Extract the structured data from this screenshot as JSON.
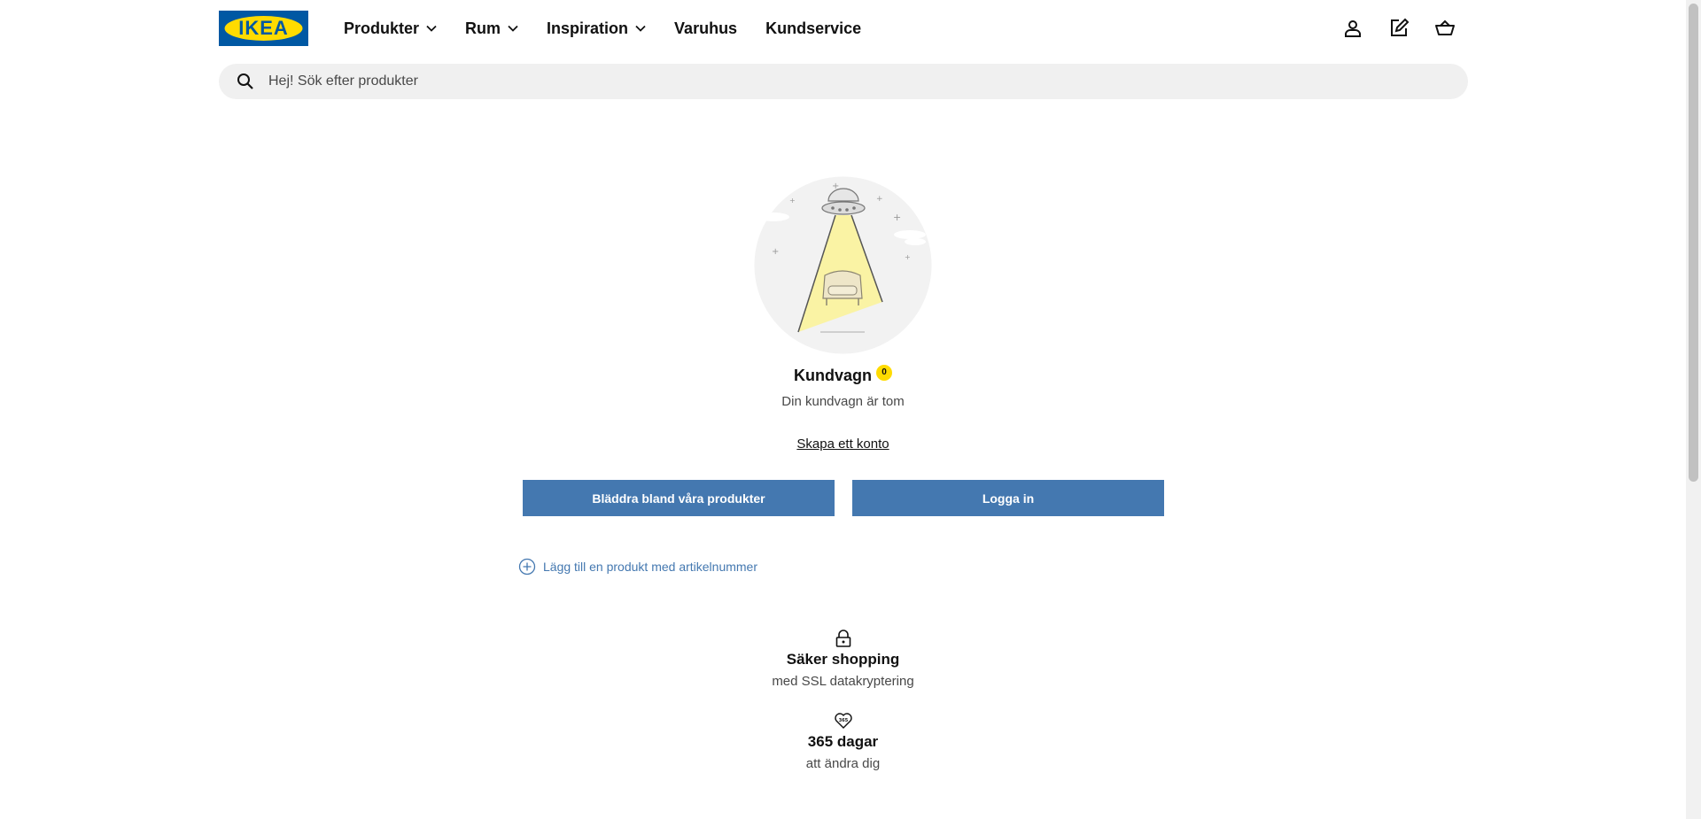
{
  "logo": {
    "text": "IKEA",
    "brand_blue": "#0058a3",
    "brand_yellow": "#ffdb00"
  },
  "nav": {
    "items": [
      {
        "label": "Produkter",
        "has_dropdown": true
      },
      {
        "label": "Rum",
        "has_dropdown": true
      },
      {
        "label": "Inspiration",
        "has_dropdown": true
      },
      {
        "label": "Varuhus",
        "has_dropdown": false
      },
      {
        "label": "Kundservice",
        "has_dropdown": false
      }
    ]
  },
  "header_icons": [
    "user-icon",
    "shopping-list-icon",
    "cart-icon"
  ],
  "search": {
    "placeholder": "Hej! Sök efter produkter"
  },
  "cart": {
    "title": "Kundvagn",
    "count": "0",
    "empty_message": "Din kundvagn är tom",
    "create_account_label": "Skapa ett konto",
    "browse_button_label": "Bläddra bland våra produkter",
    "login_button_label": "Logga in",
    "add_by_article_label": "Lägg till en produkt med artikelnummer",
    "accent_color": "#4478b0"
  },
  "features": [
    {
      "icon": "lock-icon",
      "title": "Säker shopping",
      "subtitle": "med SSL datakryptering"
    },
    {
      "icon": "heart-365-icon",
      "title": "365 dagar",
      "subtitle": "att ändra dig"
    }
  ]
}
